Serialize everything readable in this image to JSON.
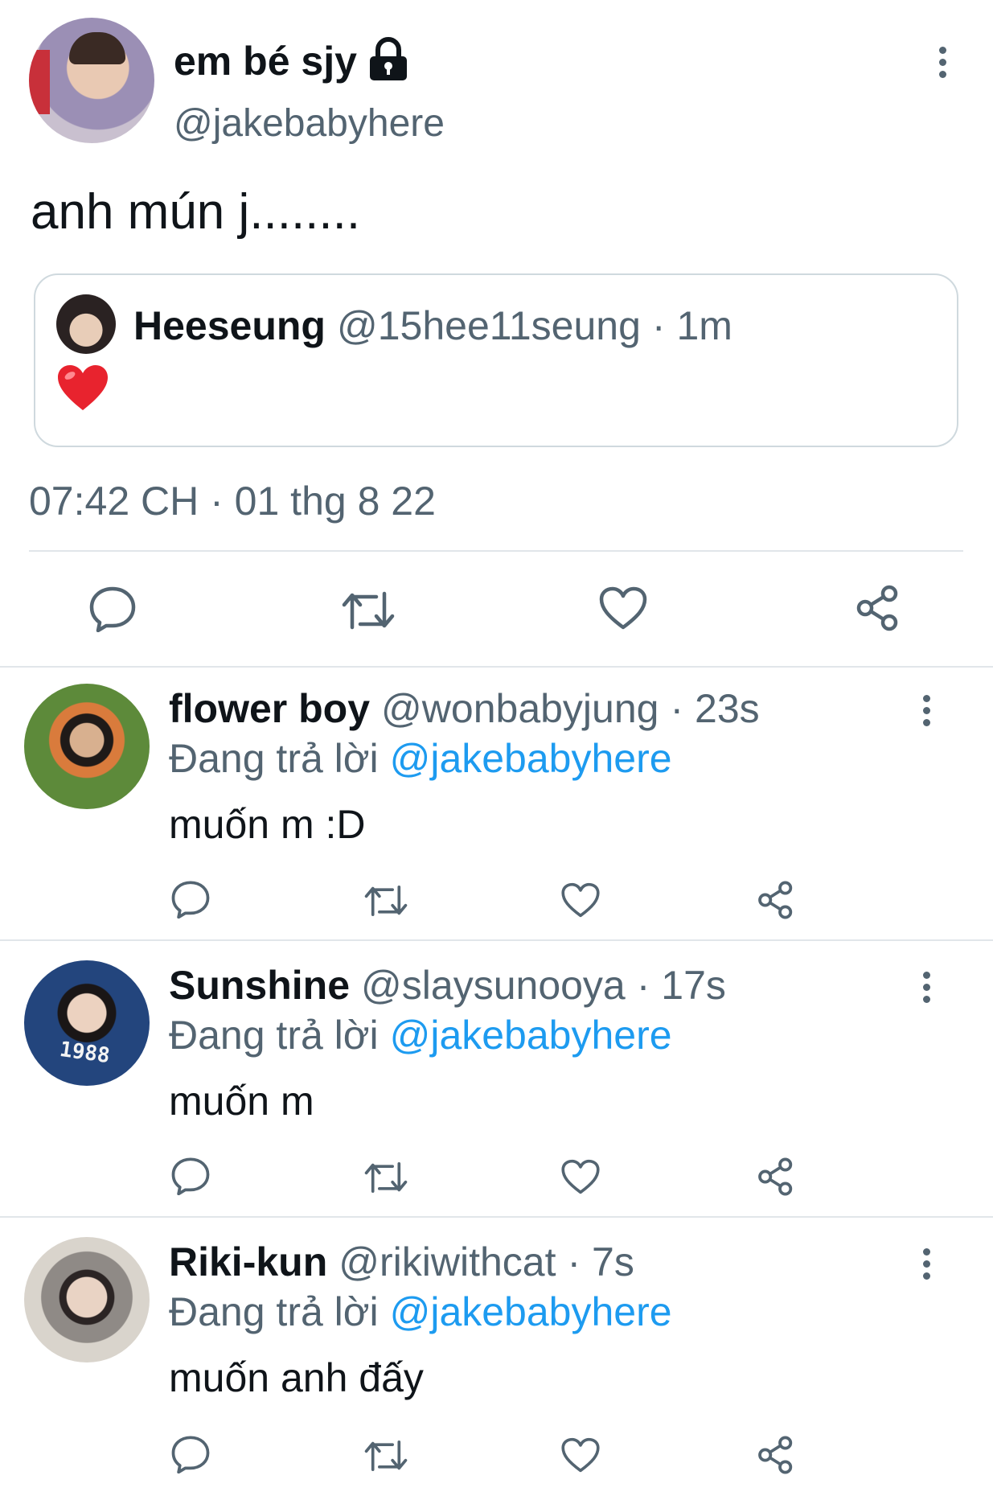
{
  "main_tweet": {
    "display_name": "em bé sjy",
    "handle": "@jakebabyhere",
    "text": "anh mún j........",
    "timestamp": "07:42 CH · 01 thg 8 22",
    "icons": {
      "lock": "lock-icon",
      "more": "more-vertical-icon"
    },
    "quoted": {
      "display_name": "Heeseung",
      "handle": "@15hee11seung",
      "time": "· 1m",
      "text": "❤️"
    }
  },
  "action_icons": [
    "reply-icon",
    "retweet-icon",
    "like-icon",
    "share-icon"
  ],
  "replies": [
    {
      "display_name": "flower boy",
      "handle": "@wonbabyjung",
      "time": "· 23s",
      "replying_prefix": "Đang trả lời",
      "replying_to": "@jakebabyhere",
      "text": "muốn m :D"
    },
    {
      "display_name": "Sunshine",
      "handle": "@slaysunooya",
      "time": "· 17s",
      "replying_prefix": "Đang trả lời",
      "replying_to": "@jakebabyhere",
      "text": "muốn m"
    },
    {
      "display_name": "Riki-kun",
      "handle": "@rikiwithcat",
      "time": "· 7s",
      "replying_prefix": "Đang trả lời",
      "replying_to": "@jakebabyhere",
      "text": "muốn anh đấy"
    }
  ],
  "colors": {
    "accent": "#1d9bf0",
    "secondary_text": "#536471",
    "divider": "#e1e6ea",
    "heart": "#e8232e"
  }
}
